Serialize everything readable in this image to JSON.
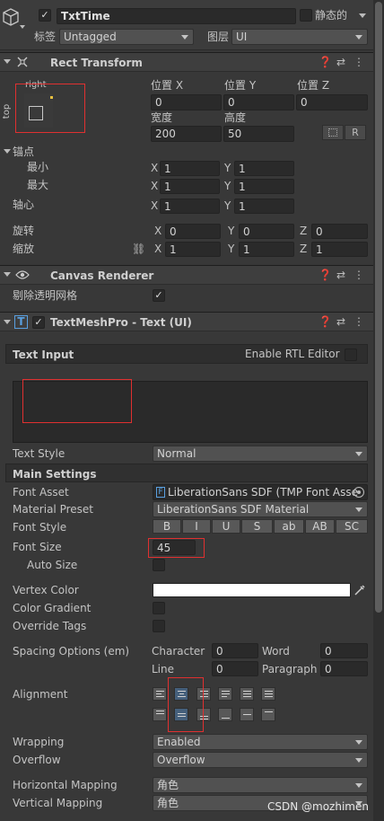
{
  "header": {
    "object_name": "TxtTime",
    "static_label": "静态的",
    "tag_label": "标签",
    "tag_value": "Untagged",
    "layer_label": "图层",
    "layer_value": "UI"
  },
  "rect_transform": {
    "title": "Rect Transform",
    "anchor_preset": {
      "h": "right",
      "v": "top"
    },
    "pos_x_label": "位置 X",
    "pos_y_label": "位置 Y",
    "pos_z_label": "位置 Z",
    "pos_x": "0",
    "pos_y": "0",
    "pos_z": "0",
    "width_label": "宽度",
    "height_label": "高度",
    "width": "200",
    "height": "50",
    "r_button": "R",
    "anchors_label": "锚点",
    "min_label": "最小",
    "max_label": "最大",
    "min_x": "1",
    "min_y": "1",
    "max_x": "1",
    "max_y": "1",
    "pivot_label": "轴心",
    "pivot_x": "1",
    "pivot_y": "1",
    "rotation_label": "旋转",
    "rot_x": "0",
    "rot_y": "0",
    "rot_z": "0",
    "scale_label": "缩放",
    "scale_x": "1",
    "scale_y": "1",
    "scale_z": "1",
    "axis_x": "X",
    "axis_y": "Y",
    "axis_z": "Z"
  },
  "canvas_renderer": {
    "title": "Canvas Renderer",
    "cull_label": "剔除透明网格"
  },
  "tmp": {
    "title": "TextMeshPro - Text (UI)",
    "text_input_label": "Text Input",
    "rtl_label": "Enable RTL Editor",
    "text_style_label": "Text Style",
    "text_style_value": "Normal",
    "main_settings": "Main Settings",
    "font_asset_label": "Font Asset",
    "font_asset_value": "LiberationSans SDF (TMP Font Asse",
    "material_label": "Material Preset",
    "material_value": "LiberationSans SDF Material",
    "font_style_label": "Font Style",
    "font_styles": [
      "B",
      "I",
      "U",
      "S",
      "ab",
      "AB",
      "SC"
    ],
    "font_size_label": "Font Size",
    "font_size": "45",
    "auto_size_label": "Auto Size",
    "vertex_color_label": "Vertex Color",
    "vertex_color": "#ffffff",
    "gradient_label": "Color Gradient",
    "override_label": "Override Tags",
    "spacing_label": "Spacing Options (em)",
    "character_label": "Character",
    "character": "0",
    "word_label": "Word",
    "word": "0",
    "line_label": "Line",
    "line": "0",
    "paragraph_label": "Paragraph",
    "paragraph": "0",
    "alignment_label": "Alignment",
    "wrapping_label": "Wrapping",
    "wrapping_value": "Enabled",
    "overflow_label": "Overflow",
    "overflow_value": "Overflow",
    "hmap_label": "Horizontal Mapping",
    "hmap_value": "角色",
    "vmap_label": "Vertical Mapping",
    "vmap_value": "角色"
  },
  "watermark": "CSDN @mozhimen",
  "colors": {
    "highlight": "#e03030",
    "selected": "#46607c"
  }
}
